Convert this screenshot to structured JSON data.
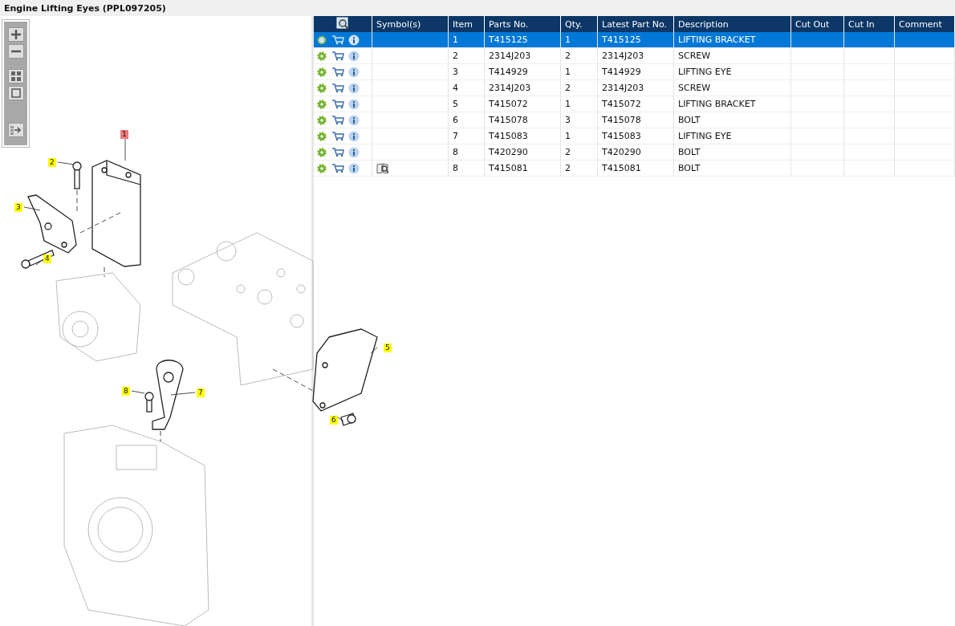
{
  "title": "Engine Lifting Eyes (PPL097205)",
  "callouts": [
    {
      "label": "1",
      "selected": true
    },
    {
      "label": "2",
      "selected": false
    },
    {
      "label": "3",
      "selected": false
    },
    {
      "label": "4",
      "selected": false
    },
    {
      "label": "5",
      "selected": false
    },
    {
      "label": "6",
      "selected": false
    },
    {
      "label": "7",
      "selected": false
    },
    {
      "label": "8",
      "selected": false
    }
  ],
  "table": {
    "columns": [
      "Symbol(s)",
      "Item",
      "Parts No.",
      "Qty.",
      "Latest Part No.",
      "Description",
      "Cut Out",
      "Cut In",
      "Comment"
    ],
    "rows": [
      {
        "item": "1",
        "parts_no": "T415125",
        "qty": "1",
        "latest": "T415125",
        "description": "LIFTING BRACKET",
        "symbol_icon": false,
        "selected": true
      },
      {
        "item": "2",
        "parts_no": "2314J203",
        "qty": "2",
        "latest": "2314J203",
        "description": "SCREW",
        "symbol_icon": false,
        "selected": false
      },
      {
        "item": "3",
        "parts_no": "T414929",
        "qty": "1",
        "latest": "T414929",
        "description": "LIFTING EYE",
        "symbol_icon": false,
        "selected": false
      },
      {
        "item": "4",
        "parts_no": "2314J203",
        "qty": "2",
        "latest": "2314J203",
        "description": "SCREW",
        "symbol_icon": false,
        "selected": false
      },
      {
        "item": "5",
        "parts_no": "T415072",
        "qty": "1",
        "latest": "T415072",
        "description": "LIFTING BRACKET",
        "symbol_icon": false,
        "selected": false
      },
      {
        "item": "6",
        "parts_no": "T415078",
        "qty": "3",
        "latest": "T415078",
        "description": "BOLT",
        "symbol_icon": false,
        "selected": false
      },
      {
        "item": "7",
        "parts_no": "T415083",
        "qty": "1",
        "latest": "T415083",
        "description": "LIFTING EYE",
        "symbol_icon": false,
        "selected": false
      },
      {
        "item": "8",
        "parts_no": "T420290",
        "qty": "2",
        "latest": "T420290",
        "description": "BOLT",
        "symbol_icon": false,
        "selected": false
      },
      {
        "item": "8",
        "parts_no": "T415081",
        "qty": "2",
        "latest": "T415081",
        "description": "BOLT",
        "symbol_icon": true,
        "selected": false
      }
    ]
  }
}
